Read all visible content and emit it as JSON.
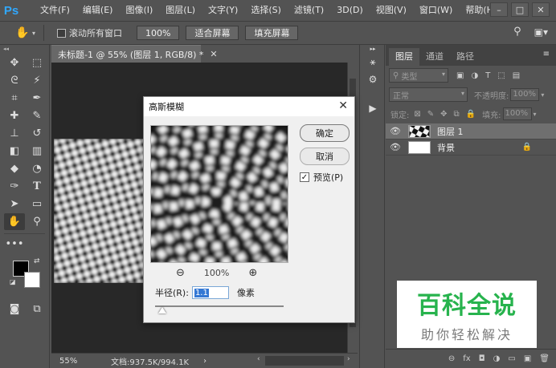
{
  "app": {
    "logo": "Ps",
    "menu": [
      "文件(F)",
      "编辑(E)",
      "图像(I)",
      "图层(L)",
      "文字(Y)",
      "选择(S)",
      "滤镜(T)",
      "3D(D)",
      "视图(V)",
      "窗口(W)",
      "帮助(H)"
    ],
    "window_buttons": [
      "–",
      "□",
      "✕"
    ]
  },
  "options_bar": {
    "scroll_all_label": "滚动所有窗口",
    "buttons": [
      "100%",
      "适合屏幕",
      "填充屏幕"
    ]
  },
  "document": {
    "tab_title": "未标题-1 @ 55% (图层 1, RGB/8) *",
    "tab_close": "✕",
    "zoom": "55%",
    "doc_info": "文档:937.5K/994.1K"
  },
  "layers_panel": {
    "tabs": [
      "图层",
      "通道",
      "路径"
    ],
    "filter_kind": "类型",
    "blend_mode": "正常",
    "opacity_label": "不透明度:",
    "opacity_value": "100%",
    "lock_label": "锁定:",
    "fill_label": "填充:",
    "fill_value": "100%",
    "layers": [
      {
        "name": "图层 1",
        "selected": true,
        "locked": false
      },
      {
        "name": "背景",
        "selected": false,
        "locked": true
      }
    ],
    "bottom_icons": [
      "link-icon",
      "fx-icon",
      "mask-icon",
      "adjustment-icon",
      "group-icon",
      "new-layer-icon",
      "trash-icon"
    ],
    "bottom_glyphs": [
      "⊖",
      "fx",
      "◘",
      "◑",
      "▭",
      "▣",
      "🗑"
    ]
  },
  "dialog": {
    "title": "高斯模糊",
    "ok_label": "确定",
    "cancel_label": "取消",
    "preview_label": "预览(P)",
    "preview_checked": true,
    "zoom_value": "100%",
    "radius_label": "半径(R):",
    "radius_value": "1.1",
    "radius_unit": "像素"
  },
  "watermark": {
    "title": "百科全说",
    "subtitle": "助你轻松解决"
  },
  "colors": {
    "accent": "#31a8ff",
    "watermark_green": "#27b34d",
    "foreground": "#000000",
    "background": "#ffffff"
  }
}
